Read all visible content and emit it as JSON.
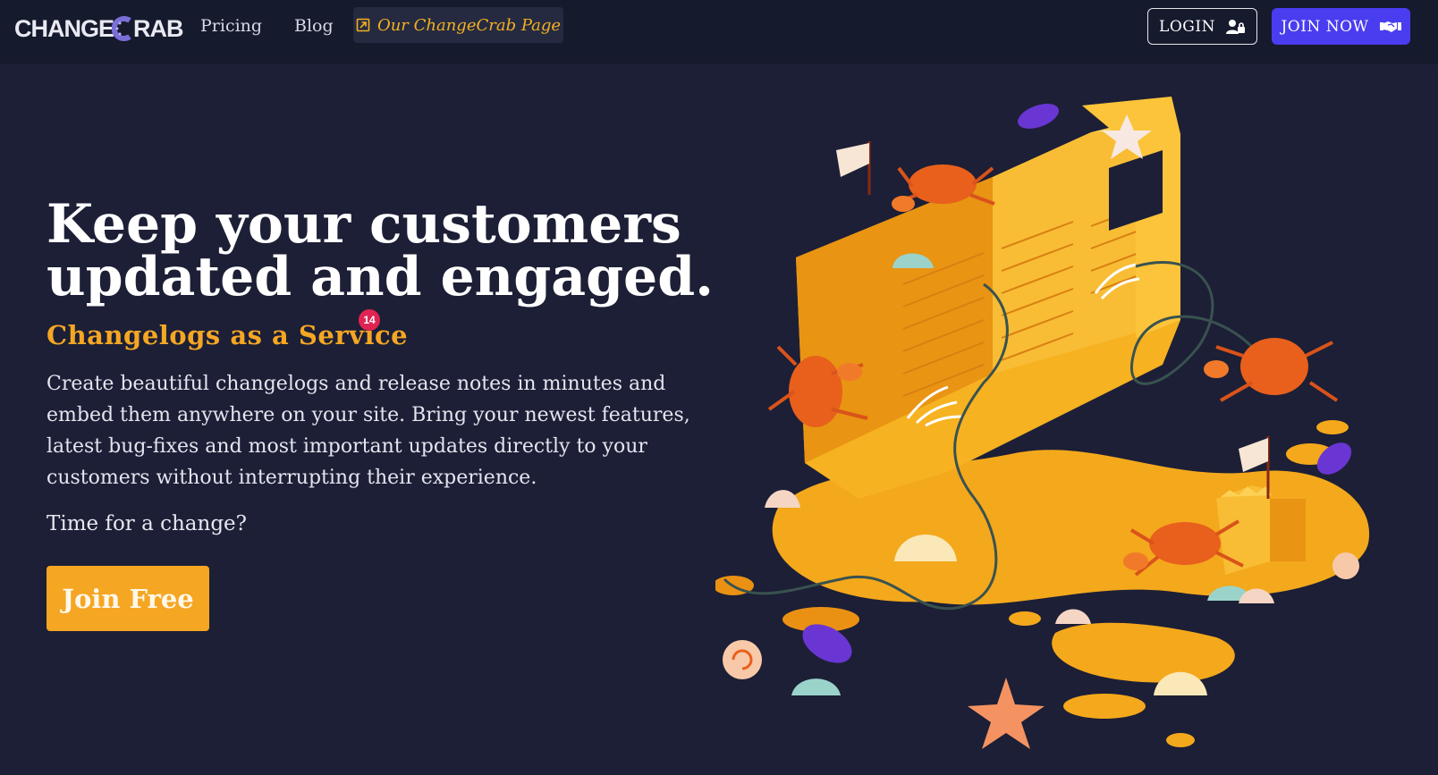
{
  "nav": {
    "logo_text_left": "CHANGE",
    "logo_text_right": "RAB",
    "pricing": "Pricing",
    "blog": "Blog",
    "external_link": "Our ChangeCrab Page",
    "login": "LOGIN",
    "join_now": "JOIN NOW"
  },
  "hero": {
    "title_line1": "Keep your customers",
    "title_line2": "updated and engaged.",
    "tagline": "Changelogs as a Service",
    "badge_count": "14",
    "description": "Create beautiful changelogs and release notes in minutes and embed them anywhere on your site. Bring your newest features, latest bug-fixes and most important updates directly to your customers without interrupting their experience.",
    "question": "Time for a change?",
    "cta": "Join Free"
  },
  "colors": {
    "background": "#1c1f36",
    "topbar": "#161a2d",
    "accent_orange": "#f5a623",
    "join_button": "#4a3df0",
    "badge": "#e02452"
  },
  "icons": {
    "external": "external-link-icon",
    "login": "user-lock-icon",
    "join": "handshake-icon"
  }
}
